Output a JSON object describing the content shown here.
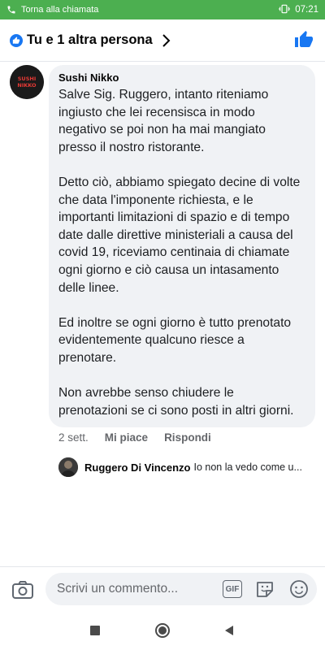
{
  "status_bar": {
    "call_text": "Torna alla chiamata",
    "time": "07:21",
    "background": "#4caf50"
  },
  "header": {
    "title": "Tu e 1 altra persona",
    "accent": "#1877f2"
  },
  "comment": {
    "author": "Sushi Nikko",
    "avatar_text": "SUSHI NIKKO",
    "paragraphs": [
      "Salve Sig. Ruggero, intanto riteniamo ingiusto che lei recensisca in modo negativo se poi non ha mai mangiato presso il nostro ristorante.",
      "Detto ciò, abbiamo spiegato decine di volte che data l'imponente richiesta, e le importanti limitazioni di spazio e di tempo date dalle direttive ministeriali a causa del covid 19, riceviamo centinaia di chiamate ogni giorno e ciò causa un intasamento delle linee.",
      "Ed inoltre se ogni giorno è tutto prenotato evidentemente qualcuno riesce a prenotare.",
      "Non avrebbe senso chiudere le prenotazioni se ci sono posti in altri giorni."
    ],
    "time_ago": "2 sett.",
    "like_label": "Mi piace",
    "reply_label": "Rispondi"
  },
  "reply_preview": {
    "author": "Ruggero Di Vincenzo",
    "text": "Io non la vedo come u..."
  },
  "composer": {
    "placeholder": "Scrivi un commento...",
    "gif_label": "GIF"
  }
}
